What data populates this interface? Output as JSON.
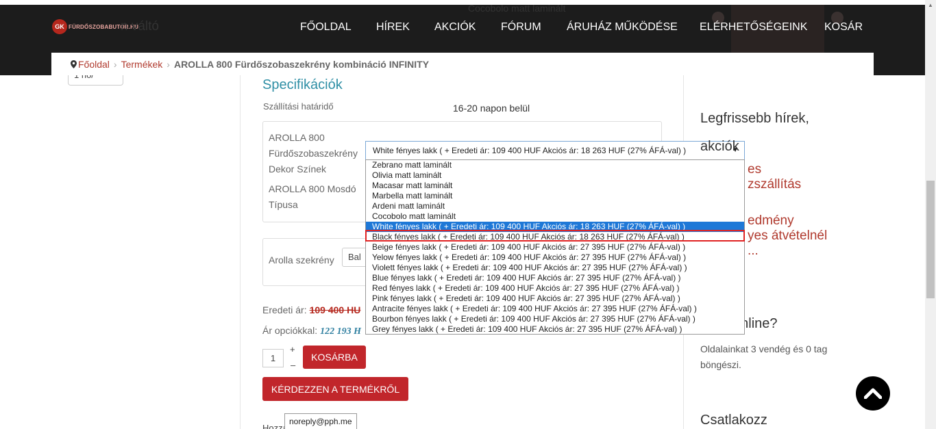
{
  "header": {
    "logo_mark": "GK",
    "logo_text": "FÜRDŐSZOBABUTOR.HU",
    "ghost_title": "n váltó",
    "ghost_promo": "Cocobolo matt laminált",
    "nav": [
      "FŐOLDAL",
      "HÍREK",
      "AKCIÓK",
      "FÓRUM",
      "ÁRUHÁZ MŰKÖDÉSE",
      "ELÉRHETŐSÉGEINK",
      "KOSÁR"
    ]
  },
  "breadcrumb": {
    "home": "Főoldal",
    "products": "Termékek",
    "current": "AROLLA 800 Fürdőszobaszekrény kombináció INFINITY"
  },
  "left": {
    "select_value": "1 hó/"
  },
  "main": {
    "spec_title": "Specifikációk",
    "shipping_label": "Szállítási határidő",
    "shipping_value": "16-20 napon belül",
    "opt_label_1": [
      "AROLLA 800",
      "Fürdőszobaszekrény",
      "Dekor Színek"
    ],
    "opt_label_2": [
      "AROLLA 800 Mosdó",
      "Típusa"
    ],
    "arolla_label": "Arolla szekrény",
    "arolla_value": "Bal",
    "orig_price_label": "Eredeti ár:",
    "orig_price_value": "109 400 HU",
    "opt_price_label": "Ár opciókkal:",
    "opt_price_value": "122 193 H",
    "qty": "1",
    "plus": "+",
    "minus": "–",
    "cart_button": "KOSÁRBA",
    "ask_button": "KÉRDEZZEN A TERMÉKRŐL",
    "tooltip": "noreply@pph.me",
    "cut_text": "Hozzá"
  },
  "dropdown": {
    "selected": "White fényes lakk ( + Eredeti ár: 109 400 HUF Akciós ár: 18 263 HUF (27% ÁFÁ-val) )",
    "options": [
      "Zebrano matt laminált",
      "Olivia matt laminált",
      "Macasar matt laminált",
      "Marbella matt laminált",
      "Ardeni matt laminált",
      "Cocobolo matt laminált",
      "White fényes lakk ( + Eredeti ár: 109 400 HUF Akciós ár: 18 263 HUF (27% ÁFÁ-val) )",
      "Black fényes lakk ( + Eredeti ár: 109 400 HUF Akciós ár: 18 263 HUF (27% ÁFÁ-val) )",
      "Beige fényes lakk ( + Eredeti ár: 109 400 HUF Akciós ár: 27 395 HUF (27% ÁFÁ-val) )",
      "Yelow fényes lakk ( + Eredeti ár: 109 400 HUF Akciós ár: 27 395 HUF (27% ÁFÁ-val) )",
      "Violett fényes lakk ( + Eredeti ár: 109 400 HUF Akciós ár: 27 395 HUF (27% ÁFÁ-val) )",
      "Blue fényes lakk ( + Eredeti ár: 109 400 HUF Akciós ár: 27 395 HUF (27% ÁFÁ-val) )",
      "Red fényes lakk ( + Eredeti ár: 109 400 HUF Akciós ár: 27 395 HUF (27% ÁFÁ-val) )",
      "Pink fényes lakk ( + Eredeti ár: 109 400 HUF Akciós ár: 27 395 HUF (27% ÁFÁ-val) )",
      "Antracite fényes lakk ( + Eredeti ár: 109 400 HUF Akciós ár: 27 395 HUF (27% ÁFÁ-val) )",
      "Bourbon fényes lakk ( + Eredeti ár: 109 400 HUF Akciós ár: 27 395 HUF (27% ÁFÁ-val) )",
      "Grey fényes lakk ( + Eredeti ár: 109 400 HUF Akciós ár: 27 395 HUF (27% ÁFÁ-val) )"
    ],
    "selected_index": 6,
    "highlighted_option": "Black fényes lakk ( + Eredeti ár: 109 400 HUF Akciós ár: 18 263 HUF (27% ÁFÁ-val) )"
  },
  "sidebar": {
    "news_title_1": "Legfrissebb hírek,",
    "news_title_2": "akciók",
    "link_1a": "es",
    "link_1b": "zszállítás",
    "link_2a": "edmény",
    "link_2b": "yes átvételnél",
    "link_2c": "...",
    "online_title": "online?",
    "online_text_1": "Oldalainkat 3 vendég és 0 tag",
    "online_text_2": "böngészi.",
    "join_title": "Csatlakozz"
  },
  "colors": {
    "accent_red": "#c1262b",
    "link_red": "#b03a2e",
    "teal": "#2f8fa5",
    "select_blue": "#1e78d7",
    "header_bg": "#1c1c1c"
  },
  "icons": [
    "location-pin-icon",
    "chevron-right-icon",
    "chevron-up-icon",
    "dropdown-arrow-icon"
  ]
}
